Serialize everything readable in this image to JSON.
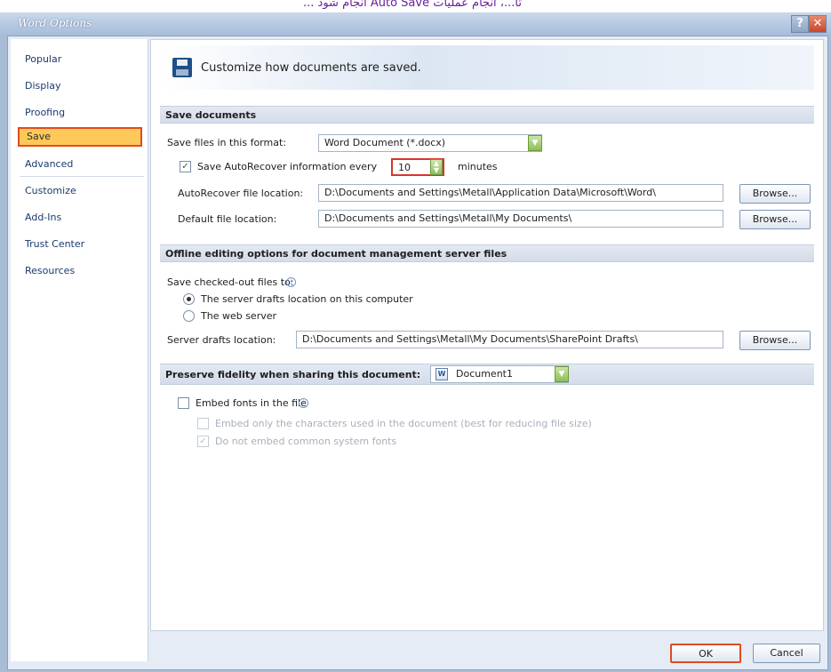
{
  "caption": "تا...، انجام عمليات Auto Save انجام شود ...",
  "window": {
    "title": "Word Options",
    "help_glyph": "?",
    "close_glyph": "✕"
  },
  "nav": {
    "items": [
      {
        "label": "Popular"
      },
      {
        "label": "Display"
      },
      {
        "label": "Proofing"
      },
      {
        "label": "Save"
      },
      {
        "label": "Advanced"
      },
      {
        "label": "Customize"
      },
      {
        "label": "Add-Ins"
      },
      {
        "label": "Trust Center"
      },
      {
        "label": "Resources"
      }
    ],
    "selected": "Save"
  },
  "header": {
    "text": "Customize how documents are saved."
  },
  "save_documents": {
    "section_title": "Save documents",
    "format_label": "Save files in this format:",
    "format_value": "Word Document (*.docx)",
    "autorecover_checked": true,
    "autorecover_label": "Save AutoRecover information every",
    "autorecover_minutes": "10",
    "minutes_label": "minutes",
    "autorecover_location_label": "AutoRecover file location:",
    "autorecover_location_value": "D:\\Documents and Settings\\Metall\\Application Data\\Microsoft\\Word\\",
    "default_location_label": "Default file location:",
    "default_location_value": "D:\\Documents and Settings\\Metall\\My Documents\\",
    "browse_label": "Browse..."
  },
  "offline": {
    "section_title": "Offline editing options for document management server files",
    "save_checked_out_label": "Save checked-out files to:",
    "option_server_drafts": "The server drafts location on this computer",
    "option_web_server": "The web server",
    "selected_option": "server_drafts",
    "server_drafts_label": "Server drafts location:",
    "server_drafts_value": "D:\\Documents and Settings\\Metall\\My Documents\\SharePoint Drafts\\",
    "browse_label": "Browse..."
  },
  "fidelity": {
    "section_title": "Preserve fidelity when sharing this document:",
    "document_value": "Document1",
    "embed_fonts_label": "Embed fonts in the file",
    "embed_fonts_checked": false,
    "embed_chars_label": "Embed only the characters used in the document (best for reducing file size)",
    "embed_chars_checked": false,
    "no_common_label": "Do not embed common system fonts",
    "no_common_checked": true
  },
  "footer": {
    "ok_label": "OK",
    "cancel_label": "Cancel"
  },
  "colors": {
    "highlight_border": "#e24b1d",
    "nav_selected_fill": "#ffc95a",
    "dialog_bg": "#e5ecf5",
    "section_bg": "#d4dcea"
  }
}
